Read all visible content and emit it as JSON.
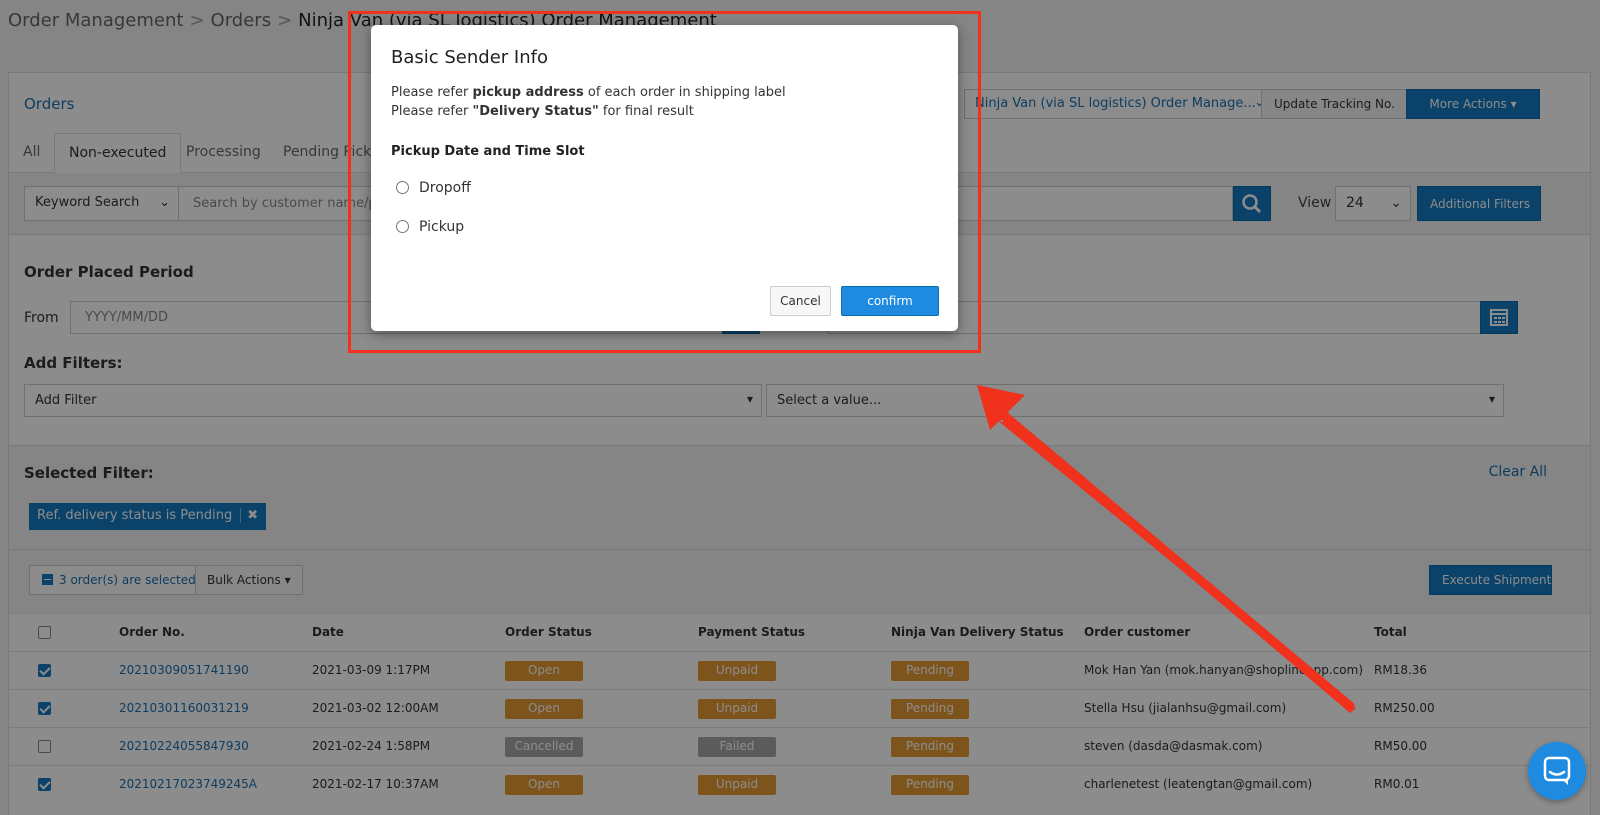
{
  "breadcrumb": {
    "items": [
      "Order Management",
      "Orders"
    ],
    "current": "Ninja Van (via SL logistics) Order Management",
    "separator": ">"
  },
  "header": {
    "title": "Orders",
    "channel_select": "Ninja Van (via SL logistics) Order Manage...",
    "update_tracking": "Update Tracking No.",
    "more_actions": "More Actions ▾"
  },
  "tabs": [
    "All",
    "Non-executed",
    "Processing",
    "Pending Pick"
  ],
  "search": {
    "keyword_select": "Keyword Search",
    "placeholder": "Search by customer name/p",
    "view_label": "View",
    "view_value": "24",
    "additional_filters": "Additional Filters"
  },
  "period": {
    "title": "Order Placed Period",
    "from_label": "From",
    "from_placeholder": "YYYY/MM/DD"
  },
  "filters": {
    "title": "Add Filters:",
    "add_filter": "Add Filter",
    "select_value": "Select a value..."
  },
  "selected_filter": {
    "title": "Selected Filter:",
    "clear_all": "Clear All",
    "chip": "Ref. delivery status is Pending"
  },
  "bulk": {
    "selected_count": "3 order(s) are selected",
    "bulk_actions": "Bulk Actions ▾",
    "execute_shipment": "Execute Shipment"
  },
  "table": {
    "columns": [
      "Order No.",
      "Date",
      "Order Status",
      "Payment Status",
      "Ninja Van Delivery Status",
      "Order customer",
      "Total"
    ],
    "rows": [
      {
        "checked": true,
        "order_no": "20210309051741190",
        "date": "2021-03-09 1:17PM",
        "order_status": "Open",
        "payment_status": "Unpaid",
        "delivery_status": "Pending",
        "customer": "Mok Han Yan (mok.hanyan@shoplineapp.com)",
        "total": "RM18.36"
      },
      {
        "checked": true,
        "order_no": "20210301160031219",
        "date": "2021-03-02 12:00AM",
        "order_status": "Open",
        "payment_status": "Unpaid",
        "delivery_status": "Pending",
        "customer": "Stella Hsu (jialanhsu@gmail.com)",
        "total": "RM250.00"
      },
      {
        "checked": false,
        "order_no": "20210224055847930",
        "date": "2021-02-24 1:58PM",
        "order_status": "Cancelled",
        "payment_status": "Failed",
        "delivery_status": "Pending",
        "customer": "steven (dasda@dasmak.com)",
        "total": "RM50.00"
      },
      {
        "checked": true,
        "order_no": "20210217023749245A",
        "date": "2021-02-17 10:37AM",
        "order_status": "Open",
        "payment_status": "Unpaid",
        "delivery_status": "Pending",
        "customer": "charlenetest (leatengtan@gmail.com)",
        "total": "RM0.01"
      }
    ]
  },
  "modal": {
    "title": "Basic Sender Info",
    "line1_pre": "Please refer ",
    "line1_bold": "pickup address",
    "line1_post": " of each order in shipping label",
    "line2_pre": "Please refer ",
    "line2_bold": "\"Delivery Status\"",
    "line2_post": " for final result",
    "subtitle": "Pickup Date and Time Slot",
    "options": [
      "Dropoff",
      "Pickup"
    ],
    "cancel": "Cancel",
    "confirm": "confirm"
  },
  "colors": {
    "accent": "#1479bf",
    "link": "#1a6fb0",
    "badge_orange": "#e59a35",
    "badge_gray": "#a7a7a7",
    "annotation_red": "#f0311c"
  }
}
